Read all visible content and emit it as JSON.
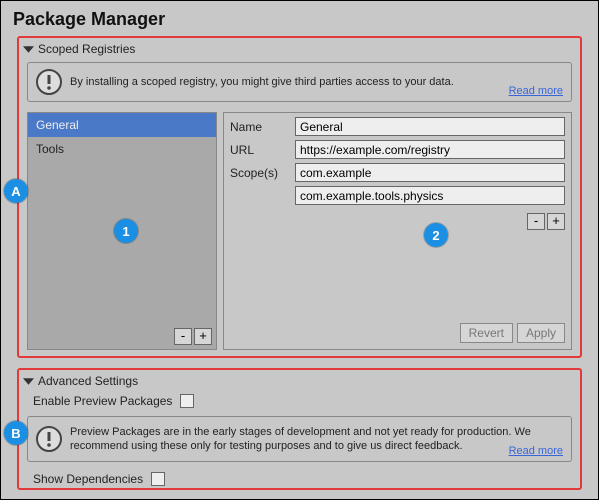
{
  "window_title": "Package Manager",
  "scoped_registries": {
    "header": "Scoped Registries",
    "info": "By installing a scoped registry, you might give third parties access to your data.",
    "read_more": "Read more",
    "registries": [
      "General",
      "Tools"
    ],
    "selected_index": 0,
    "form": {
      "name_label": "Name",
      "name_value": "General",
      "url_label": "URL",
      "url_value": "https://example.com/registry",
      "scopes_label": "Scope(s)",
      "scope_values": [
        "com.example",
        "com.example.tools.physics"
      ]
    },
    "buttons": {
      "minus": "-",
      "plus": "+",
      "revert": "Revert",
      "apply": "Apply"
    }
  },
  "advanced": {
    "header": "Advanced Settings",
    "enable_preview_label": "Enable Preview Packages",
    "enable_preview_checked": false,
    "info": "Preview Packages are in the early stages of development and not yet ready for production. We recommend using these only for testing purposes and to give us direct feedback.",
    "read_more": "Read more",
    "show_deps_label": "Show Dependencies",
    "show_deps_checked": false
  },
  "callouts": {
    "A": "A",
    "B": "B",
    "one": "1",
    "two": "2"
  }
}
